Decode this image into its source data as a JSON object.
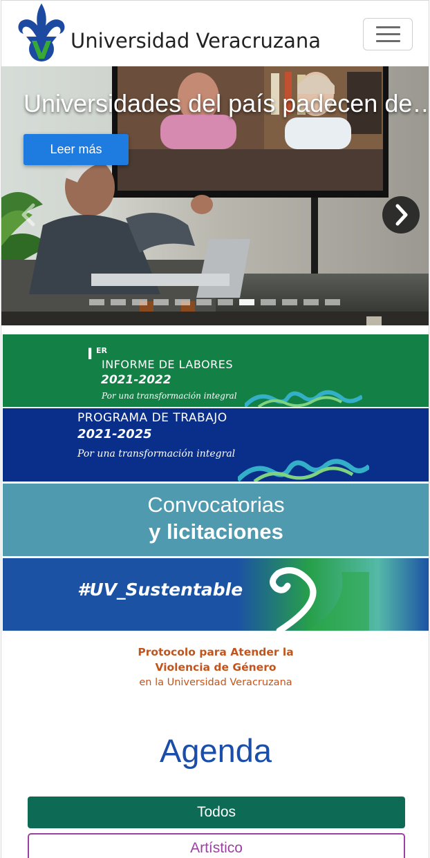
{
  "header": {
    "brand": "Universidad Veracruzana",
    "logo_icon": "uv-fleur-de-lis-logo",
    "menu_icon": "hamburger-menu-icon"
  },
  "carousel": {
    "title": "Universidades del país padecen de…",
    "read_more": "Leer más",
    "prev_icon": "chevron-left-icon",
    "next_icon": "chevron-right-icon",
    "slide_count": 12,
    "active_index": 7
  },
  "banners": {
    "informe": {
      "ordinal": "I",
      "ordinal_sup": "ER",
      "title": "INFORME DE LABORES",
      "years": "2021-2022",
      "subtitle": "Por una transformación integral"
    },
    "programa": {
      "title": "PROGRAMA DE TRABAJO",
      "years": "2021-2025",
      "subtitle": "Por una transformación integral"
    },
    "convocatorias": {
      "line1": "Convocatorias",
      "line2": "y licitaciones"
    },
    "sustentable": {
      "hashtag": "#UV_Sustentable"
    }
  },
  "protocolo": {
    "line1": "Protocolo para Atender la",
    "line2": "Violencia de Género",
    "line3": "en la Universidad Veracruzana"
  },
  "agenda": {
    "title": "Agenda",
    "filters": [
      "Todos",
      "Artístico"
    ]
  },
  "colors": {
    "brand_blue": "#1a4ea8",
    "primary_button": "#1e7be0",
    "informe_green": "#138046",
    "programa_navy": "#0a2f8a",
    "convocatorias_teal": "#509aaf",
    "sustentable_blue": "#1c52a4",
    "protocolo_orange": "#c2541c",
    "todos_green": "#0d6b55",
    "artistico_purple": "#9c3fa3"
  }
}
